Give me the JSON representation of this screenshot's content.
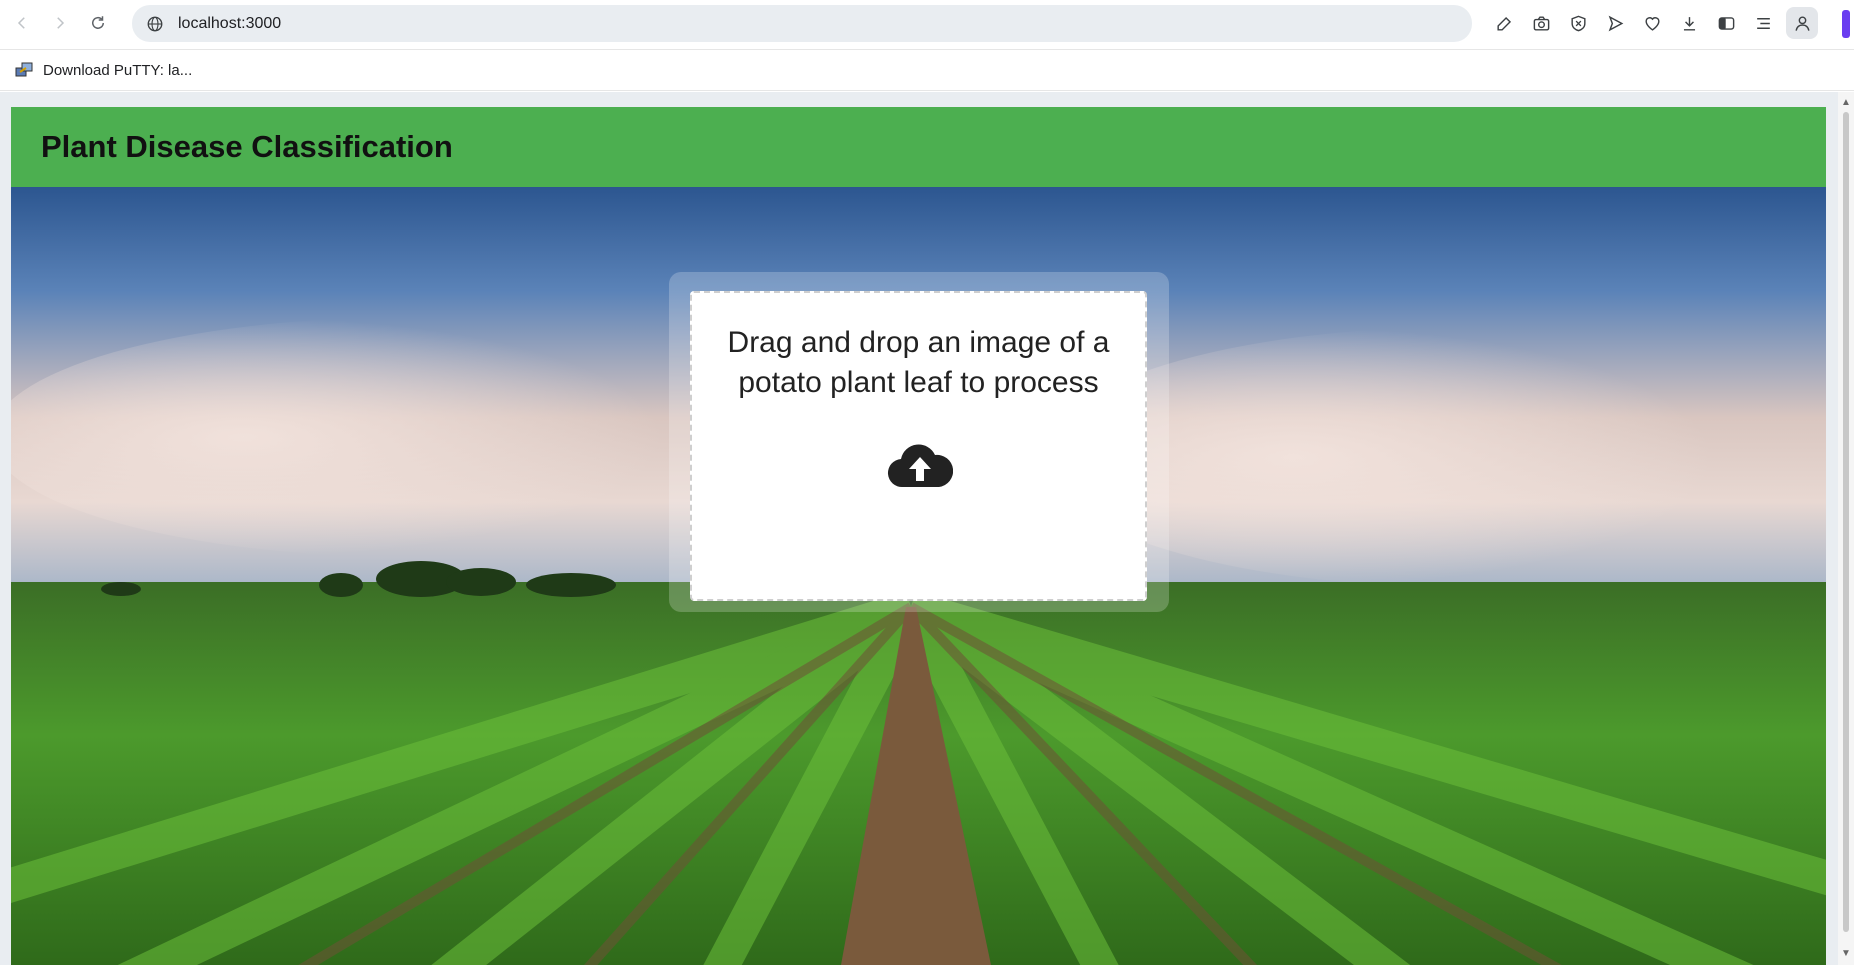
{
  "browser": {
    "url": "localhost:3000",
    "bookmark_label": "Download PuTTY: la...",
    "accent_color": "#6a3df0"
  },
  "app": {
    "title": "Plant Disease Classification",
    "header_color": "#4caf50",
    "dropzone_text": "Drag and drop an image of a potato plant leaf to process",
    "upload_icon": "cloud-upload-icon"
  }
}
